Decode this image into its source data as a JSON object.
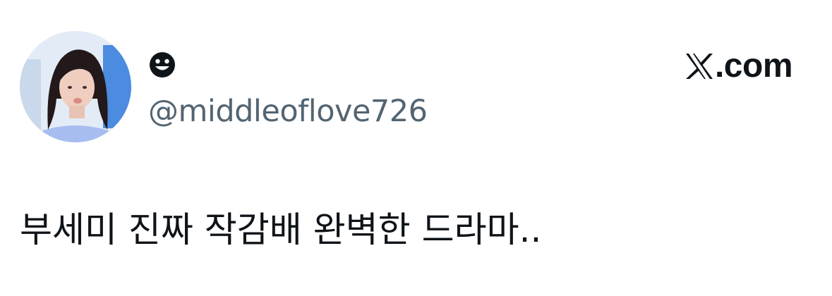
{
  "tweet": {
    "display_name": "☻",
    "display_name_icon": "smiling-face-icon",
    "handle": "@middleoflove726",
    "text": "부세미 진짜 작감배 완벽한 드라마.."
  },
  "brand": {
    "x_glyph": "𝕏",
    "domain": ".com",
    "icon": "x-logo-icon"
  },
  "colors": {
    "text_primary": "#0f1419",
    "text_secondary": "#536471",
    "background": "#ffffff"
  }
}
